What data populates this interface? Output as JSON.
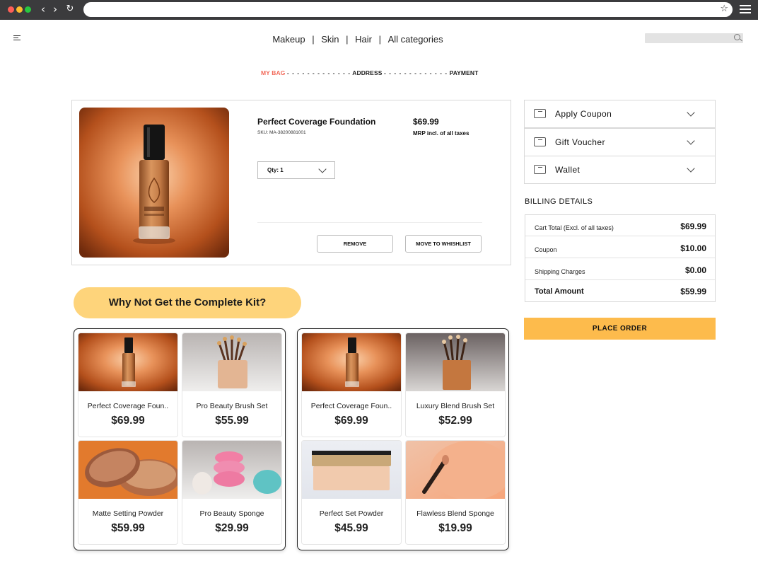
{
  "nav": {
    "links": [
      "Makeup",
      "Skin",
      "Hair",
      "All categories"
    ],
    "separator": "|"
  },
  "steps": {
    "bag": "MY BAG",
    "address": "ADDRESS",
    "payment": "PAYMENT",
    "dashes": "- - - - - - - - - - - - -"
  },
  "cart_item": {
    "name": "Perfect Coverage Foundation",
    "sku": "SKU: MA-38200881001",
    "price": "$69.99",
    "mrp_note": "MRP incl. of all taxes",
    "qty_label": "Qty: 1",
    "remove_label": "REMOVE",
    "wishlist_label": "MOVE TO WHISHLIST"
  },
  "offers": {
    "coupon": "Apply Coupon",
    "voucher": "Gift Voucher",
    "wallet": "Wallet"
  },
  "billing": {
    "title": "BILLING DETAILS",
    "rows": [
      {
        "label": "Cart Total (Excl. of all taxes)",
        "value": "$69.99"
      },
      {
        "label": "Coupon",
        "value": "$10.00"
      },
      {
        "label": "Shipping Charges",
        "value": "$0.00"
      },
      {
        "label": "Total Amount",
        "value": "$59.99"
      }
    ],
    "place_order": "PLACE ORDER"
  },
  "kit": {
    "title": "Why Not Get the Complete Kit?",
    "sets": [
      {
        "items": [
          {
            "name": "Perfect Coverage Foun..",
            "price": "$69.99"
          },
          {
            "name": "Pro Beauty Brush Set",
            "price": "$55.99"
          },
          {
            "name": "Matte Setting Powder",
            "price": "$59.99"
          },
          {
            "name": "Pro Beauty Sponge",
            "price": "$29.99"
          }
        ]
      },
      {
        "items": [
          {
            "name": "Perfect Coverage Foun..",
            "price": "$69.99"
          },
          {
            "name": "Luxury Blend Brush Set",
            "price": "$52.99"
          },
          {
            "name": "Perfect Set Powder",
            "price": "$45.99"
          },
          {
            "name": "Flawless Blend Sponge",
            "price": "$19.99"
          }
        ]
      }
    ]
  },
  "colors": {
    "accent_step": "#f26b5b",
    "place_order_bg": "#fdbb4c",
    "kit_banner_bg": "#fed47b"
  }
}
